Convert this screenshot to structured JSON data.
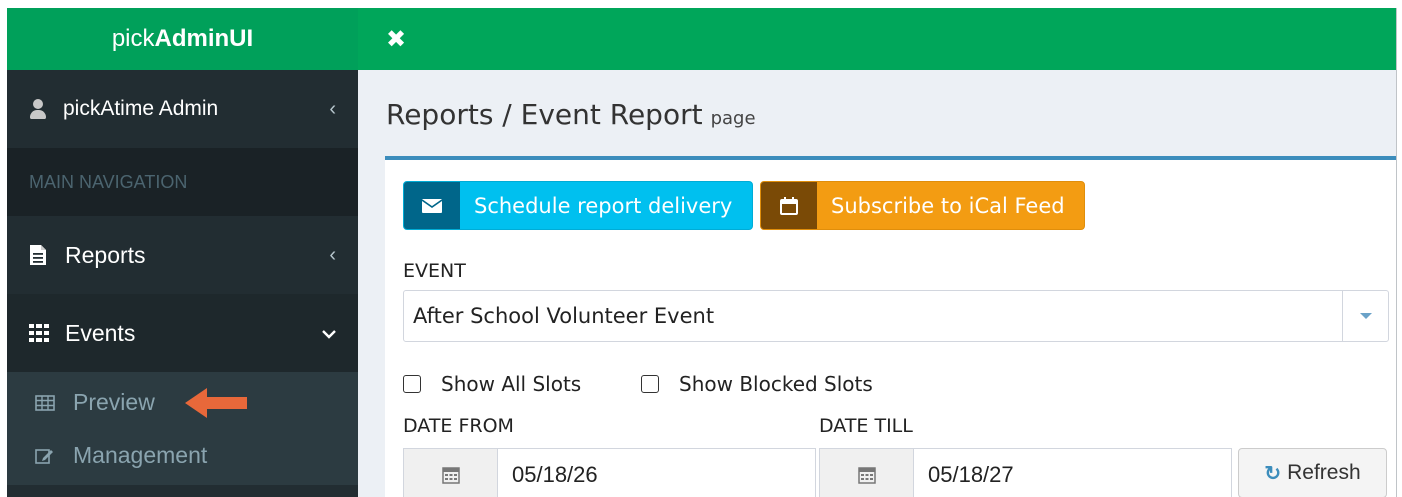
{
  "app": {
    "logo_light": "pick",
    "logo_bold": "AdminUI"
  },
  "sidebar": {
    "user": {
      "name": "pickAtime Admin"
    },
    "nav_header": "MAIN NAVIGATION",
    "items": [
      {
        "label": "Reports"
      },
      {
        "label": "Events"
      }
    ],
    "submenu": [
      {
        "label": "Preview"
      },
      {
        "label": "Management"
      }
    ]
  },
  "topbar": {
    "close_glyph": "✖"
  },
  "page": {
    "title": "Reports / Event Report",
    "subtitle": "page"
  },
  "buttons": {
    "schedule": "Schedule report delivery",
    "ical": "Subscribe to iCal Feed",
    "refresh": "Refresh"
  },
  "form": {
    "event_label": "EVENT",
    "event_value": "After School Volunteer Event",
    "show_all_slots": "Show All Slots",
    "show_blocked_slots": "Show Blocked Slots",
    "date_from_label": "DATE FROM",
    "date_from_value": "05/18/26",
    "date_till_label": "DATE TILL",
    "date_till_value": "05/18/27"
  },
  "colors": {
    "brand_green": "#00a65a",
    "sidebar_bg": "#222d32",
    "accent_blue": "#3c8dbc",
    "info": "#00c0ef",
    "warning": "#f39c12",
    "arrow": "#e8683a"
  },
  "icons": {
    "user": "user-icon",
    "reports": "file-text-icon",
    "events": "grid-icon",
    "preview": "table-icon",
    "management": "edit-icon",
    "schedule": "envelope-icon",
    "ical": "calendar-icon",
    "refresh": "refresh-icon"
  }
}
